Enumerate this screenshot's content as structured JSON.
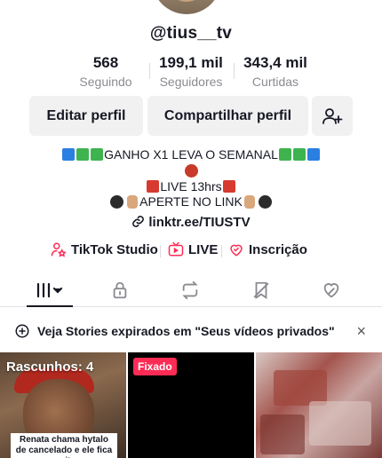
{
  "profile": {
    "username": "@tius__tv",
    "add_badge": "+"
  },
  "stats": [
    {
      "value": "568",
      "label": "Seguindo"
    },
    {
      "value": "199,1 mil",
      "label": "Seguidores"
    },
    {
      "value": "343,4 mil",
      "label": "Curtidas"
    }
  ],
  "actions": {
    "edit_label": "Editar perfil",
    "share_label": "Compartilhar perfil",
    "add_friend_icon": "person-plus-icon"
  },
  "bio": {
    "line1": "GANHO X1 LEVA O SEMANAL",
    "line3": "LIVE 13hrs",
    "line4": "APERTE NO LINK",
    "link": "linktr.ee/TIUSTV"
  },
  "shortcuts": [
    {
      "label": "TikTok Studio",
      "icon": "studio-icon"
    },
    {
      "label": "LIVE",
      "icon": "live-icon"
    },
    {
      "label": "Inscrição",
      "icon": "subscription-icon"
    }
  ],
  "tabs": [
    {
      "name": "videos",
      "icon": "grid-icon"
    },
    {
      "name": "private",
      "icon": "lock-icon"
    },
    {
      "name": "reposts",
      "icon": "repost-icon"
    },
    {
      "name": "favorites",
      "icon": "bookmark-icon"
    },
    {
      "name": "liked",
      "icon": "heart-icon"
    }
  ],
  "banner": {
    "text": "Veja Stories expirados em \"Seus vídeos privados\"",
    "close": "×"
  },
  "videos": {
    "draft_label": "Rascunhos: 4",
    "draft_caption": "Renata chama hytalo de cancelado e ele fica muito",
    "pinned_label": "Fixado"
  },
  "colors": {
    "accent": "#fe2c55",
    "avatar_badge": "#20d5ec",
    "secondary_text": "#8a8b91",
    "button_bg": "#f1f1f2"
  }
}
